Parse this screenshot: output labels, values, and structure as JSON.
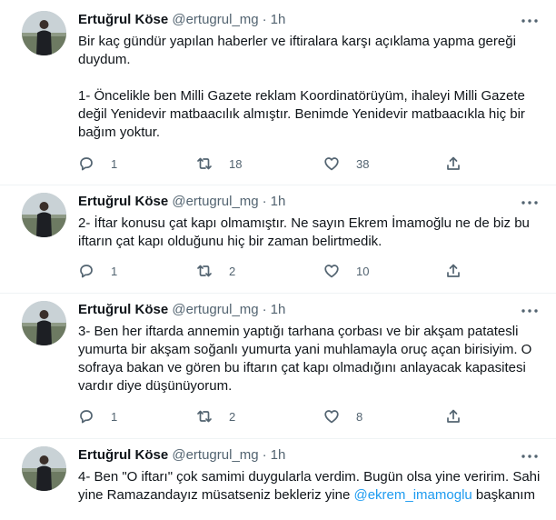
{
  "tweets": [
    {
      "name": "Ertuğrul Köse",
      "handle": "@ertugrul_mg",
      "dot": "·",
      "time": "1h",
      "text": "Bir kaç gündür yapılan haberler ve iftiralara karşı açıklama yapma gereği duydum.\n\n1- Öncelikle ben Milli Gazete reklam Koordinatörüyüm, ihaleyi Milli Gazete değil Yenidevir matbaacılık almıştır. Benimde Yenidevir matbaacıkla hiç bir bağım yoktur.",
      "replies": "1",
      "retweets": "18",
      "likes": "38"
    },
    {
      "name": "Ertuğrul Köse",
      "handle": "@ertugrul_mg",
      "dot": "·",
      "time": "1h",
      "text": "2- İftar konusu çat kapı olmamıştır. Ne sayın Ekrem İmamoğlu ne de biz bu iftarın çat kapı olduğunu hiç bir zaman belirtmedik.",
      "replies": "1",
      "retweets": "2",
      "likes": "10"
    },
    {
      "name": "Ertuğrul Köse",
      "handle": "@ertugrul_mg",
      "dot": "·",
      "time": "1h",
      "text": "3- Ben her iftarda annemin yaptığı tarhana çorbası ve bir akşam patatesli yumurta bir akşam soğanlı yumurta yani muhlamayla oruç açan birisiyim. O sofraya bakan ve gören bu iftarın çat kapı olmadığını anlayacak kapasitesi vardır diye düşünüyorum.",
      "replies": "1",
      "retweets": "2",
      "likes": "8"
    },
    {
      "name": "Ertuğrul Köse",
      "handle": "@ertugrul_mg",
      "dot": "·",
      "time": "1h",
      "text_before": "4- Ben \"O iftarı\" çok samimi duygularla verdim. Bugün olsa yine veririm. Sahi yine Ramazandayız müsatseniz bekleriz yine ",
      "mention": "@ekrem_imamoglu",
      "text_after": " başkanım"
    }
  ],
  "icons": {
    "more": "more-dots-icon",
    "reply": "reply-icon",
    "retweet": "retweet-icon",
    "like": "heart-icon",
    "share": "share-icon"
  },
  "colors": {
    "text": "#0f1419",
    "secondary": "#536471",
    "link": "#1d9bf0",
    "divider": "#eff3f4"
  }
}
